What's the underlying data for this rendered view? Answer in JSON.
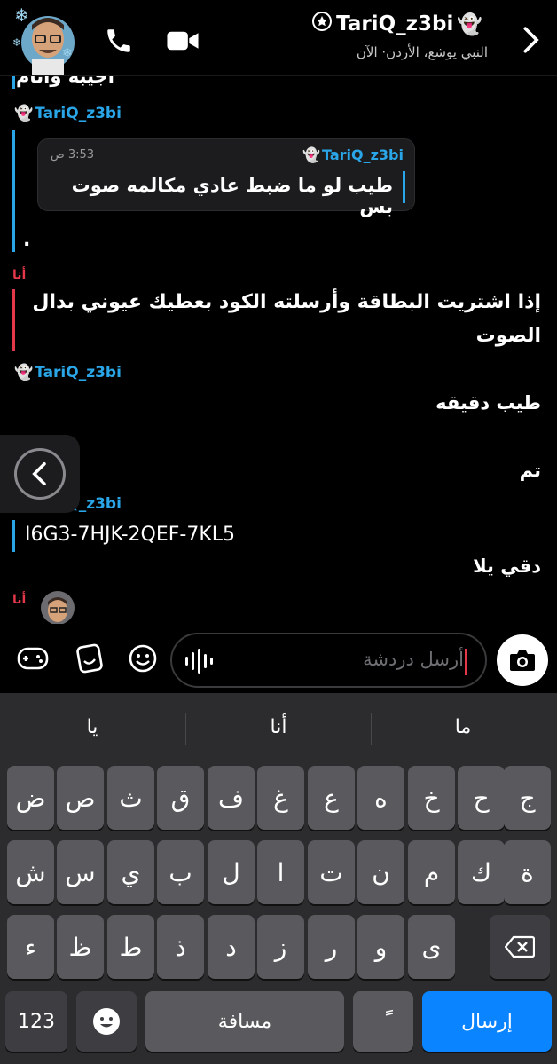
{
  "header": {
    "title": "TariQ_z3bi",
    "subtitle": "النبي يوشع، الأردن· الآن"
  },
  "chat": {
    "top_partial": "اجيبه وانام",
    "sender_name": "TariQ_z3bi",
    "me_label": "أنا",
    "quote": {
      "sender": "TariQ_z3bi",
      "time": "3:53 ص",
      "text": "طيب لو ما ضبط عادي مكالمه صوت بس"
    },
    "dot": ".",
    "my_message_line1": "إذا اشتريت البطاقة وأرسلته الكود بعطيك عيوني بدال",
    "my_message_line2": "الصوت",
    "msg_wait": "طيب دقيقه",
    "msg_done": "تم",
    "code": "I6G3-7HJK-2QEF-7KL5",
    "msg_quick": "دقي يلا"
  },
  "compose": {
    "placeholder": "أرسل دردشة"
  },
  "keyboard": {
    "suggestions": [
      "يا",
      "أنا",
      "ما"
    ],
    "row1": [
      "ض",
      "ص",
      "ث",
      "ق",
      "ف",
      "غ",
      "ع",
      "ه",
      "خ",
      "ح",
      "ج"
    ],
    "row2": [
      "ش",
      "س",
      "ي",
      "ب",
      "ل",
      "ا",
      "ت",
      "ن",
      "م",
      "ك",
      "ة"
    ],
    "row3": [
      "ء",
      "ظ",
      "ط",
      "ذ",
      "د",
      "ز",
      "ر",
      "و",
      "ى"
    ],
    "numbers_key": "123",
    "space_key": "مسافة",
    "diacritic_key": "ً",
    "send_key": "إرسال"
  },
  "colors": {
    "accent_blue": "#2aa6e8",
    "me_red": "#e2384a",
    "send_blue": "#0a84ff"
  }
}
